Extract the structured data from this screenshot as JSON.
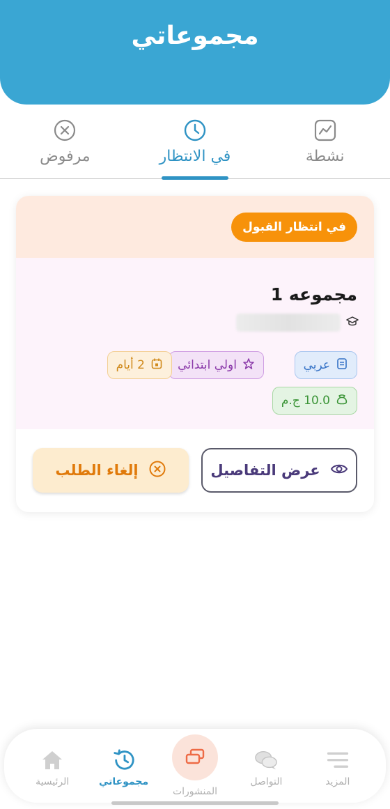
{
  "header": {
    "title": "مجموعاتي"
  },
  "tabs": [
    {
      "label": "نشطة",
      "icon": "chart-line-icon"
    },
    {
      "label": "في الانتظار",
      "icon": "clock-icon",
      "active": true
    },
    {
      "label": "مرفوض",
      "icon": "x-circle-icon"
    }
  ],
  "card": {
    "status": "في انتظار القبول",
    "title": "مجموعه 1",
    "teacher_icon": "graduation-cap-icon",
    "chips": {
      "subject": "عربي",
      "grade": "اولي ابتدائي",
      "duration": "2 أيام",
      "price": "10.0 ج.م"
    },
    "actions": {
      "details": "عرض التفاصيل",
      "cancel": "إلغاء الطلب"
    }
  },
  "bottom_nav": [
    {
      "label": "المزيد",
      "icon": "menu-icon"
    },
    {
      "label": "التواصل",
      "icon": "chat-icon"
    },
    {
      "label": "المنشورات",
      "icon": "posts-icon"
    },
    {
      "label": "مجموعاتي",
      "icon": "history-icon",
      "active": true
    },
    {
      "label": "الرئيسية",
      "icon": "home-icon"
    }
  ],
  "colors": {
    "primary": "#3aa6d3",
    "accent": "#f7920a",
    "active_tab": "#2f93c4"
  }
}
